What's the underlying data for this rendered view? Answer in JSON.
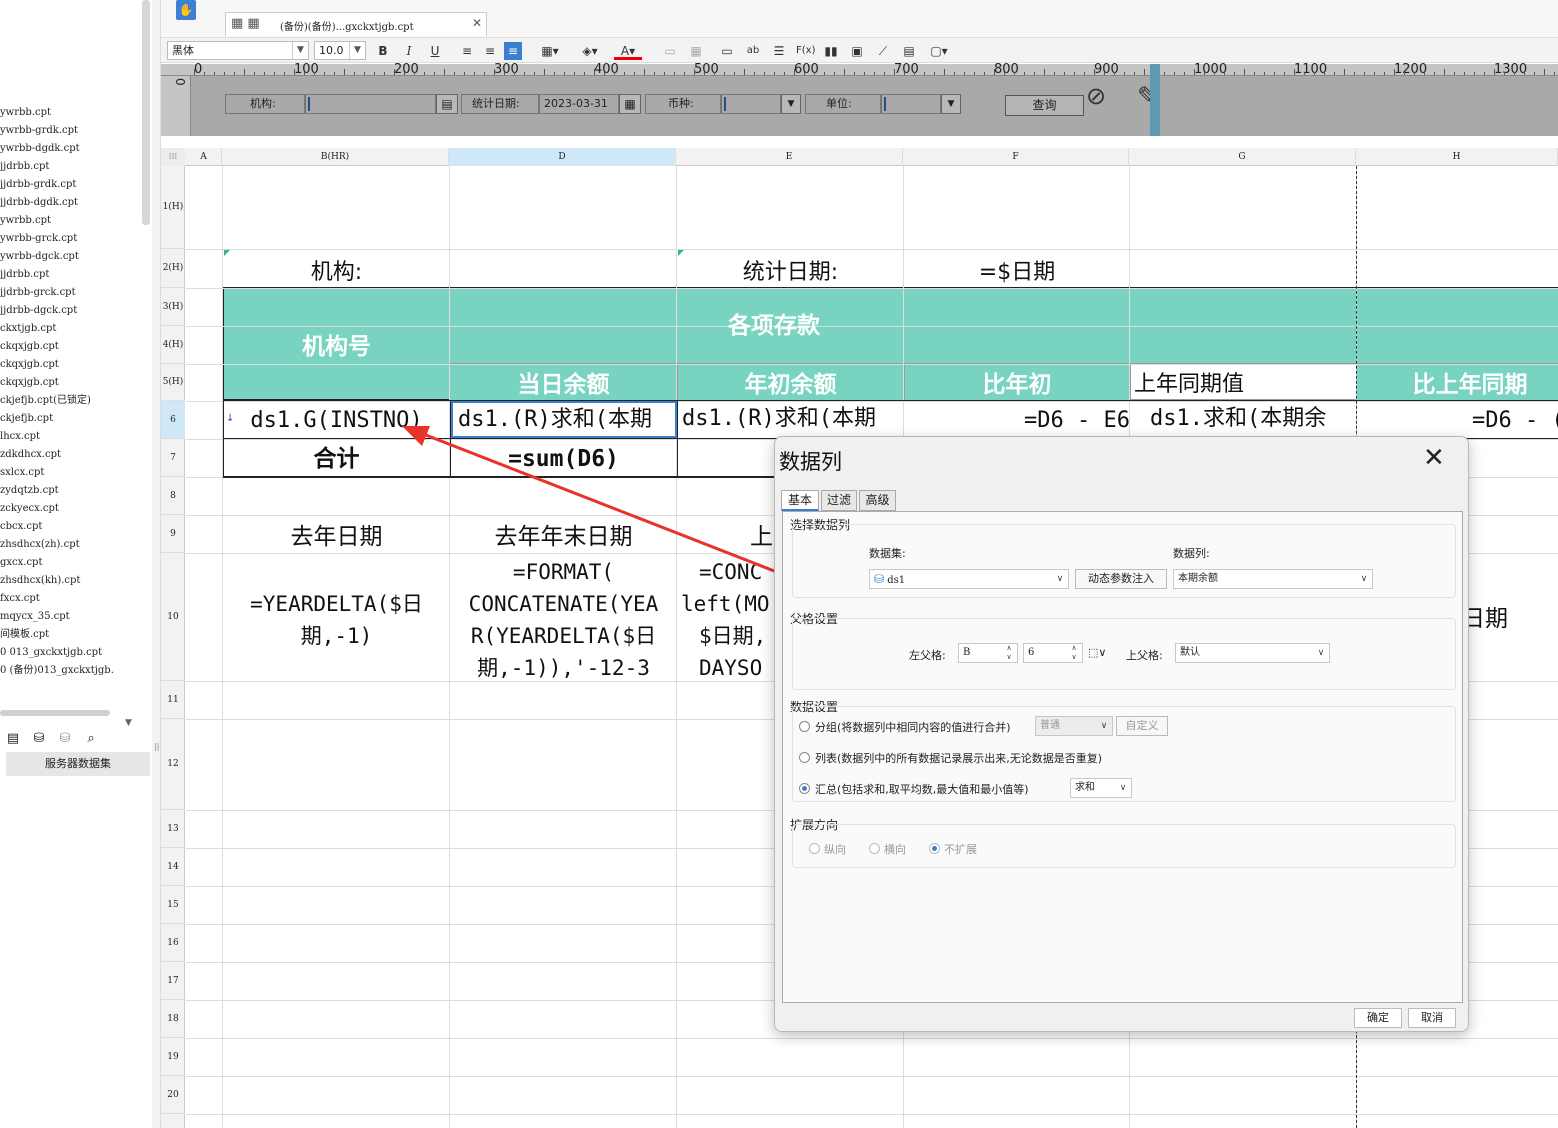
{
  "files": [
    "ywrbb.cpt",
    "ywrbb-grdk.cpt",
    "ywrbb-dgdk.cpt",
    "jjdrbb.cpt",
    "jjdrbb-grdk.cpt",
    "jjdrbb-dgdk.cpt",
    "ywrbb.cpt",
    "ywrbb-grck.cpt",
    "ywrbb-dgck.cpt",
    "jjdrbb.cpt",
    "jjdrbb-grck.cpt",
    "jjdrbb-dgck.cpt",
    "ckxtjgb.cpt",
    "ckqxjgb.cpt",
    "ckqxjgb.cpt",
    "ckqxjgb.cpt",
    "ckjefjb.cpt(已锁定)",
    "ckjefjb.cpt",
    "lhcx.cpt",
    "zdkdhcx.cpt",
    "sxlcx.cpt",
    "zydqtzb.cpt",
    "zckyecx.cpt",
    "cbcx.cpt",
    "zhsdhcx(zh).cpt",
    "gxcx.cpt",
    "zhsdhcx(kh).cpt",
    "fxcx.cpt",
    "mqycx_35.cpt",
    "间模板.cpt",
    "0 013_gxckxtjgb.cpt",
    "0 (备份)013_gxckxtjgb."
  ],
  "sidebar": {
    "server_dataset_label": "服务器数据集"
  },
  "tab": {
    "title": "(备份)(备份)...gxckxtjgb.cpt"
  },
  "format": {
    "font_name": "黑体",
    "font_size": "10.0"
  },
  "ruler": [
    "0",
    "100",
    "200",
    "300",
    "400",
    "500",
    "600",
    "700",
    "800",
    "900",
    "1000",
    "1100",
    "1200",
    "1300"
  ],
  "params": {
    "org_label": "机构:",
    "date_label": "统计日期:",
    "date_value": "2023-03-31",
    "currency_label": "币种:",
    "unit_label": "单位:",
    "query_label": "查询"
  },
  "columns": [
    "A",
    "B(HR)",
    "D",
    "E",
    "F",
    "G",
    "H"
  ],
  "rows": [
    "1(H)",
    "2(H)",
    "3(H)",
    "4(H)",
    "5(H)",
    "6",
    "7",
    "8",
    "9",
    "10",
    "11",
    "12",
    "13",
    "14",
    "15",
    "16",
    "17",
    "18",
    "19",
    "20"
  ],
  "sheet": {
    "r2_org": "机构:",
    "r2_date": "统计日期:",
    "r2_date_formula": "=$日期",
    "hdr_org_no": "机构号",
    "hdr_deposits": "各项存款",
    "hdr_day_balance": "当日余额",
    "hdr_year_start": "年初余额",
    "hdr_vs_year_start": "比年初",
    "hdr_last_year_same": "上年同期值",
    "hdr_vs_last_year": "比上年同期",
    "r6_b": "ds1.G(INSTNO)",
    "r6_d": "ds1.(R)求和(本期",
    "r6_e": "ds1.(R)求和(本期",
    "r6_f": "=D6 - E6",
    "r6_g": "ds1.求和(本期余",
    "r6_h": "=D6 - (",
    "r7_b": "合计",
    "r7_d": "=sum(D6)",
    "r9_b": "去年日期",
    "r9_d": "去年年末日期",
    "r9_e": "上",
    "r10_b": [
      "=YEARDELTA($日",
      "期,-1)"
    ],
    "r10_d": [
      "=FORMAT(",
      "CONCATENATE(YEA",
      "R(YEARDELTA($日",
      "期,-1)),'-12-3"
    ],
    "r10_e": [
      "=CONC",
      "left(MO",
      "$日期,",
      "DAYSO"
    ],
    "r10_h": "日期"
  },
  "dialog": {
    "title": "数据列",
    "tabs": [
      "基本",
      "过滤",
      "高级"
    ],
    "select_group": "选择数据列",
    "dataset_label": "数据集:",
    "dataset_value": "ds1",
    "dynamic_param_button": "动态参数注入",
    "column_label": "数据列:",
    "column_value": "本期余额",
    "parent_group": "父格设置",
    "left_parent_label": "左父格:",
    "left_parent_col": "B",
    "left_parent_row": "6",
    "top_parent_label": "上父格:",
    "top_parent_value": "默认",
    "data_group": "数据设置",
    "opt_group": "分组(将数据列中相同内容的值进行合并)",
    "opt_group_mode": "普通",
    "opt_group_custom": "自定义",
    "opt_list": "列表(数据列中的所有数据记录展示出来,无论数据是否重复)",
    "opt_summary": "汇总(包括求和,取平均数,最大值和最小值等)",
    "opt_summary_value": "求和",
    "expand_group": "扩展方向",
    "expand_vertical": "纵向",
    "expand_horizontal": "横向",
    "expand_none": "不扩展",
    "ok_button": "确定",
    "cancel_button": "取消"
  },
  "colors": {
    "header_teal": "#78d4c0",
    "arrow_red": "#e8332a",
    "selection_blue": "#3a7fd0"
  }
}
